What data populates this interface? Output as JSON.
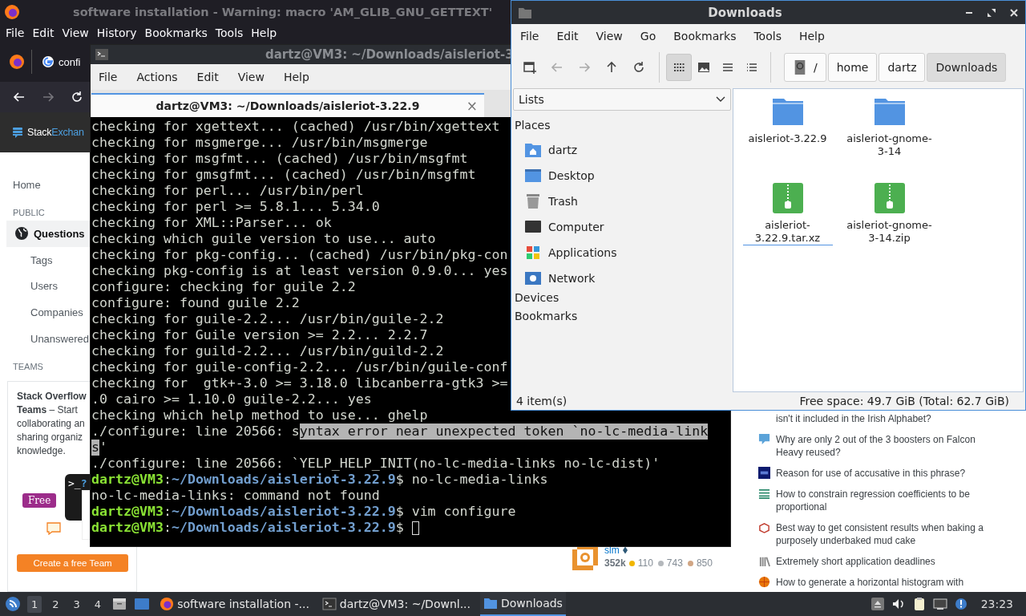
{
  "browser": {
    "title": "software installation - Warning: macro 'AM_GLIB_GNU_GETTEXT'",
    "menu": [
      "File",
      "Edit",
      "View",
      "History",
      "Bookmarks",
      "Tools",
      "Help"
    ],
    "tab": {
      "label": "confi"
    },
    "site": {
      "logo_1": "Stack",
      "logo_2": "Exchan"
    },
    "sidebar": [
      {
        "label": "Home",
        "kind": "item",
        "selected": false
      },
      {
        "label": "PUBLIC",
        "kind": "header",
        "selected": false
      },
      {
        "label": "Questions",
        "kind": "primary",
        "selected": true
      },
      {
        "label": "Tags",
        "kind": "sub",
        "selected": false
      },
      {
        "label": "Users",
        "kind": "sub",
        "selected": false
      },
      {
        "label": "Companies",
        "kind": "sub",
        "selected": false
      },
      {
        "label": "Unanswered",
        "kind": "sub",
        "selected": false
      },
      {
        "label": "TEAMS",
        "kind": "header",
        "selected": false
      }
    ],
    "teams_card": {
      "lines": [
        "**Stack Overflow**",
        "**Teams** – Start",
        "collaborating an",
        "sharing organiz",
        "knowledge."
      ],
      "prompt": ">_",
      "question_mark": "?",
      "badge": "Free",
      "button": "Create a free Team"
    },
    "user_card": {
      "name": "slm",
      "reputation": "352k",
      "gold": "110",
      "silver": "743",
      "bronze": "850"
    },
    "hot_questions": [
      {
        "kind": "none",
        "title": "isn't it included in the Irish Alphabet?"
      },
      {
        "kind": "sx",
        "title": "Why are only 2 out of the 3 boosters on Falcon Heavy reused?"
      },
      {
        "kind": "de",
        "title": "Reason for use of accusative in this phrase?"
      },
      {
        "kind": "stats",
        "title": "How to constrain regression coefficients to be proportional"
      },
      {
        "kind": "cake",
        "title": "Best way to get consistent results when baking a purposely underbaked mud cake"
      },
      {
        "kind": "books",
        "title": "Extremely short application deadlines"
      },
      {
        "kind": "ball",
        "title": "How to generate a horizontal histogram with"
      }
    ]
  },
  "terminal": {
    "title": "dartz@VM3: ~/Downloads/aisleriot-3",
    "menu": [
      "File",
      "Actions",
      "Edit",
      "View",
      "Help"
    ],
    "tab": {
      "label": "dartz@VM3: ~/Downloads/aisleriot-3.22.9",
      "close": "×"
    },
    "lines": [
      {
        "kind": "output",
        "segments": [
          {
            "text": "checking for xgettext... (cached) /usr/bin/xgettext",
            "selected": false
          }
        ]
      },
      {
        "kind": "output",
        "segments": [
          {
            "text": "checking for msgmerge... /usr/bin/msgmerge",
            "selected": false
          }
        ]
      },
      {
        "kind": "output",
        "segments": [
          {
            "text": "checking for msgfmt... (cached) /usr/bin/msgfmt",
            "selected": false
          }
        ]
      },
      {
        "kind": "output",
        "segments": [
          {
            "text": "checking for gmsgfmt... (cached) /usr/bin/msgfmt",
            "selected": false
          }
        ]
      },
      {
        "kind": "output",
        "segments": [
          {
            "text": "checking for perl... /usr/bin/perl",
            "selected": false
          }
        ]
      },
      {
        "kind": "output",
        "segments": [
          {
            "text": "checking for perl >= 5.8.1... 5.34.0",
            "selected": false
          }
        ]
      },
      {
        "kind": "output",
        "segments": [
          {
            "text": "checking for XML::Parser... ok",
            "selected": false
          }
        ]
      },
      {
        "kind": "output",
        "segments": [
          {
            "text": "checking which guile version to use... auto",
            "selected": false
          }
        ]
      },
      {
        "kind": "output",
        "segments": [
          {
            "text": "checking for pkg-config... (cached) /usr/bin/pkg-con",
            "selected": false
          }
        ]
      },
      {
        "kind": "output",
        "segments": [
          {
            "text": "checking pkg-config is at least version 0.9.0... yes",
            "selected": false
          }
        ]
      },
      {
        "kind": "output",
        "segments": [
          {
            "text": "configure: checking for guile 2.2",
            "selected": false
          }
        ]
      },
      {
        "kind": "output",
        "segments": [
          {
            "text": "configure: found guile 2.2",
            "selected": false
          }
        ]
      },
      {
        "kind": "output",
        "segments": [
          {
            "text": "checking for guile-2.2... /usr/bin/guile-2.2",
            "selected": false
          }
        ]
      },
      {
        "kind": "output",
        "segments": [
          {
            "text": "checking for Guile version >= 2.2... 2.2.7",
            "selected": false
          }
        ]
      },
      {
        "kind": "output",
        "segments": [
          {
            "text": "checking for guild-2.2... /usr/bin/guild-2.2",
            "selected": false
          }
        ]
      },
      {
        "kind": "output",
        "segments": [
          {
            "text": "checking for guile-config-2.2... /usr/bin/guile-conf",
            "selected": false
          }
        ]
      },
      {
        "kind": "output",
        "segments": [
          {
            "text": "checking for  gtk+-3.0 >= 3.18.0 libcanberra-gtk3 >=",
            "selected": false
          }
        ]
      },
      {
        "kind": "output",
        "segments": [
          {
            "text": ".0 cairo >= 1.10.0 guile-2.2... yes",
            "selected": false
          }
        ]
      },
      {
        "kind": "output",
        "segments": [
          {
            "text": "checking which help method to use... ghelp",
            "selected": false
          }
        ]
      },
      {
        "kind": "output",
        "segments": [
          {
            "text": "./configure: line 20566: s",
            "selected": false
          },
          {
            "text": "yntax error near unexpected token `no-lc-media-link",
            "selected": true
          }
        ]
      },
      {
        "kind": "output",
        "segments": [
          {
            "text": "s",
            "selected": true
          },
          {
            "text": "'",
            "selected": false
          }
        ]
      },
      {
        "kind": "output",
        "segments": [
          {
            "text": "./configure: line 20566: `YELP_HELP_INIT(no-lc-media-links no-lc-dist)'",
            "selected": false
          }
        ]
      },
      {
        "kind": "prompt",
        "user": "dartz@VM3",
        "separator": ":",
        "path": "~/Downloads/aisleriot-3.22.9",
        "command": "$ no-lc-media-links"
      },
      {
        "kind": "output",
        "segments": [
          {
            "text": "no-lc-media-links: command not found",
            "selected": false
          }
        ]
      },
      {
        "kind": "prompt",
        "user": "dartz@VM3",
        "separator": ":",
        "path": "~/Downloads/aisleriot-3.22.9",
        "command": "$ vim configure"
      },
      {
        "kind": "prompt",
        "user": "dartz@VM3",
        "separator": ":",
        "path": "~/Downloads/aisleriot-3.22.9",
        "command": "$",
        "cursor": true
      }
    ]
  },
  "file_manager": {
    "title": "Downloads",
    "menu": [
      "File",
      "Edit",
      "View",
      "Go",
      "Bookmarks",
      "Tools",
      "Help"
    ],
    "views": [
      {
        "kind": "icons",
        "selected": true
      },
      {
        "kind": "thumbnails",
        "selected": false
      },
      {
        "kind": "compact",
        "selected": false
      },
      {
        "kind": "details",
        "selected": false
      }
    ],
    "path": [
      {
        "label": "/",
        "kind": "root",
        "selected": false
      },
      {
        "label": "home",
        "kind": "dir",
        "selected": false
      },
      {
        "label": "dartz",
        "kind": "dir",
        "selected": false
      },
      {
        "label": "Downloads",
        "kind": "dir",
        "selected": true
      }
    ],
    "side_mode": "Lists",
    "sections": [
      {
        "title": "Places",
        "items": [
          {
            "label": "dartz",
            "kind": "home"
          },
          {
            "label": "Desktop",
            "kind": "desktop"
          },
          {
            "label": "Trash",
            "kind": "trash"
          },
          {
            "label": "Computer",
            "kind": "computer"
          },
          {
            "label": "Applications",
            "kind": "apps"
          },
          {
            "label": "Network",
            "kind": "network"
          }
        ]
      },
      {
        "title": "Devices"
      },
      {
        "title": "Bookmarks"
      }
    ],
    "files": [
      {
        "name": "aisleriot-3.22.9",
        "kind": "folder",
        "focused": false
      },
      {
        "name": "aisleriot-gnome-3-14",
        "kind": "folder",
        "focused": false
      },
      {
        "name": "aisleriot-3.22.9.tar.xz",
        "kind": "archive",
        "focused": true
      },
      {
        "name": "aisleriot-gnome-3-14.zip",
        "kind": "archive",
        "focused": false
      }
    ],
    "status_left": "4 item(s)",
    "status_right": "Free space: 49.7 GiB (Total: 62.7 GiB)"
  },
  "taskbar": {
    "workspaces": [
      {
        "label": "1",
        "selected": true
      },
      {
        "label": "2",
        "selected": false
      },
      {
        "label": "3",
        "selected": false
      },
      {
        "label": "4",
        "selected": false
      }
    ],
    "tasks": [
      {
        "label": "software installation -...",
        "kind": "firefox",
        "selected": false
      },
      {
        "label": "dartz@VM3: ~/Downl...",
        "kind": "terminal",
        "selected": false
      },
      {
        "label": "Downloads",
        "kind": "folder",
        "selected": true
      }
    ],
    "clock": "23:23"
  }
}
